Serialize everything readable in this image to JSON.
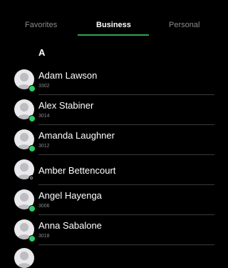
{
  "tabs": [
    {
      "label": "Favorites",
      "active": false
    },
    {
      "label": "Business",
      "active": true
    },
    {
      "label": "Personal",
      "active": false
    }
  ],
  "accent_color": "#2ea44f",
  "section": {
    "letter": "A"
  },
  "contacts": [
    {
      "name": "Adam Lawson",
      "extension": "3302",
      "status": "available"
    },
    {
      "name": "Alex Stabiner",
      "extension": "3014",
      "status": "available"
    },
    {
      "name": "Amanda Laughner",
      "extension": "3012",
      "status": "available"
    },
    {
      "name": "Amber Bettencourt",
      "extension": "",
      "status": "offline"
    },
    {
      "name": "Angel Hayenga",
      "extension": "3006",
      "status": "available"
    },
    {
      "name": "Anna Sabalone",
      "extension": "3018",
      "status": "available"
    }
  ],
  "icons": {
    "avatar": "person-placeholder-icon",
    "presence_available": "green-dot-icon",
    "presence_offline": "hollow-circle-icon"
  }
}
